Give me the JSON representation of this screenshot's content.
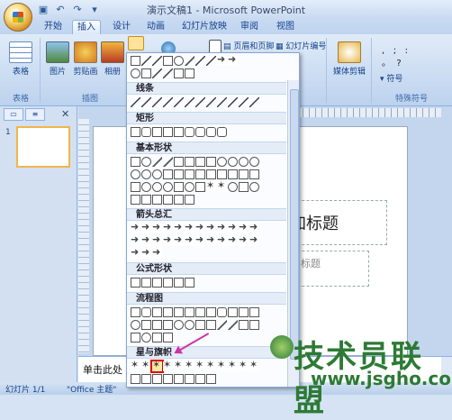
{
  "window": {
    "title": "演示文稿1 - Microsoft PowerPoint"
  },
  "quick_access": [
    "save-icon",
    "undo-icon",
    "redo-icon",
    "customize-icon"
  ],
  "tabs": [
    {
      "label": "开始"
    },
    {
      "label": "插入",
      "active": true
    },
    {
      "label": "设计"
    },
    {
      "label": "动画"
    },
    {
      "label": "幻灯片放映"
    },
    {
      "label": "审阅"
    },
    {
      "label": "视图"
    }
  ],
  "ribbon": {
    "table_label": "表格",
    "table_group": "表格",
    "picture_label": "图片",
    "clipart_label": "剪贴画",
    "album_label": "相册",
    "illustrations_group": "插图",
    "header_footer_label": "页眉和页脚",
    "slide_number_label": "幻灯片编号",
    "media_clip_label": "媒体剪辑",
    "symbol_label": "符号",
    "special_symbols_group": "特殊符号"
  },
  "gallery": {
    "sections": [
      {
        "title": "线条"
      },
      {
        "title": "矩形"
      },
      {
        "title": "基本形状"
      },
      {
        "title": "箭头总汇"
      },
      {
        "title": "公式形状"
      },
      {
        "title": "流程图"
      },
      {
        "title": "星与旗帜"
      }
    ]
  },
  "slide": {
    "title_placeholder": "加标题",
    "subtitle_placeholder": "标题"
  },
  "notes": {
    "placeholder": "单击此处"
  },
  "status": {
    "slide_info": "幻灯片 1/1",
    "theme": "\"Office 主题\""
  },
  "thumbnail": {
    "number": "1"
  },
  "watermark": {
    "text": "技术员联盟",
    "url": "www.jsgho.com"
  },
  "colors": {
    "accent": "#15428b",
    "selection": "#d00000",
    "arrow": "#d033a8",
    "watermark": "#2d7a35"
  }
}
